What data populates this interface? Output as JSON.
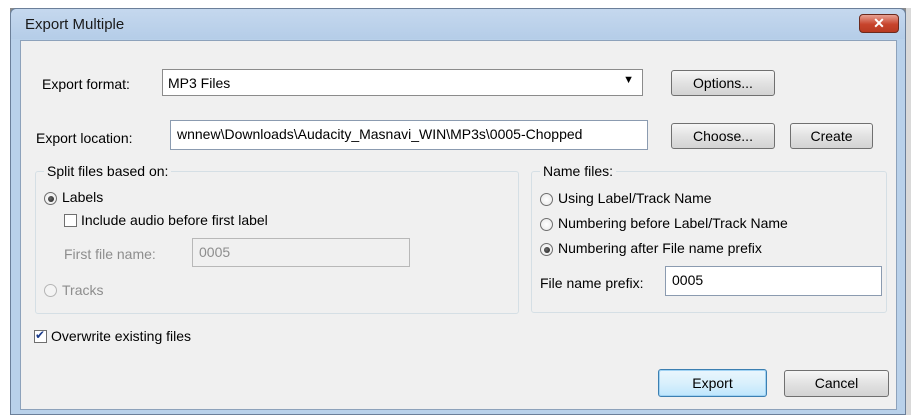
{
  "window": {
    "title": "Export Multiple",
    "close_glyph": "✕"
  },
  "export": {
    "format_label": "Export format:",
    "format_value": "MP3 Files",
    "format_arrow": "▼",
    "options_label": "Options...",
    "location_label": "Export location:",
    "location_value": "wnnew\\Downloads\\Audacity_Masnavi_WIN\\MP3s\\0005-Chopped",
    "choose_label": "Choose...",
    "create_label": "Create"
  },
  "split": {
    "title": "Split files based on:",
    "labels_option": "Labels",
    "labels_selected": true,
    "include_audio_label": "Include audio before first label",
    "include_audio_checked": false,
    "first_file_label": "First file name:",
    "first_file_value": "0005",
    "tracks_option": "Tracks",
    "tracks_selected": false
  },
  "name": {
    "title": "Name files:",
    "option_label_track": "Using Label/Track Name",
    "option_numbering_before": "Numbering before Label/Track Name",
    "option_numbering_after": "Numbering after File name prefix",
    "selected": "numbering_after",
    "prefix_label": "File name prefix:",
    "prefix_value": "0005"
  },
  "overwrite": {
    "label": "Overwrite existing files",
    "checked": true
  },
  "actions": {
    "export_label": "Export",
    "cancel_label": "Cancel"
  },
  "colors": {
    "title_bar": "#b9d1ea",
    "close_button": "#c7442c",
    "dialog_bg": "#f0f0f0"
  }
}
